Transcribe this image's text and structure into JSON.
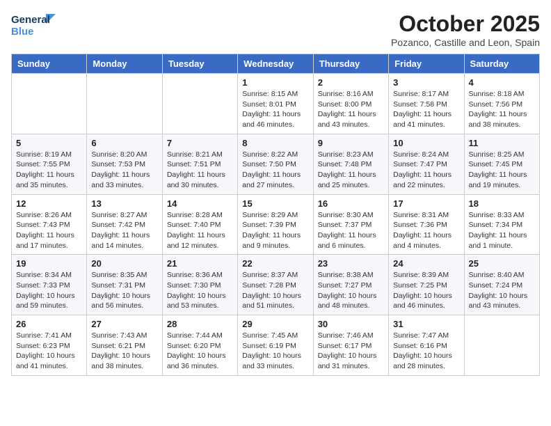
{
  "logo": {
    "line1": "General",
    "line2": "Blue"
  },
  "title": "October 2025",
  "location": "Pozanco, Castille and Leon, Spain",
  "weekdays": [
    "Sunday",
    "Monday",
    "Tuesday",
    "Wednesday",
    "Thursday",
    "Friday",
    "Saturday"
  ],
  "weeks": [
    [
      {
        "day": "",
        "info": ""
      },
      {
        "day": "",
        "info": ""
      },
      {
        "day": "",
        "info": ""
      },
      {
        "day": "1",
        "info": "Sunrise: 8:15 AM\nSunset: 8:01 PM\nDaylight: 11 hours and 46 minutes."
      },
      {
        "day": "2",
        "info": "Sunrise: 8:16 AM\nSunset: 8:00 PM\nDaylight: 11 hours and 43 minutes."
      },
      {
        "day": "3",
        "info": "Sunrise: 8:17 AM\nSunset: 7:58 PM\nDaylight: 11 hours and 41 minutes."
      },
      {
        "day": "4",
        "info": "Sunrise: 8:18 AM\nSunset: 7:56 PM\nDaylight: 11 hours and 38 minutes."
      }
    ],
    [
      {
        "day": "5",
        "info": "Sunrise: 8:19 AM\nSunset: 7:55 PM\nDaylight: 11 hours and 35 minutes."
      },
      {
        "day": "6",
        "info": "Sunrise: 8:20 AM\nSunset: 7:53 PM\nDaylight: 11 hours and 33 minutes."
      },
      {
        "day": "7",
        "info": "Sunrise: 8:21 AM\nSunset: 7:51 PM\nDaylight: 11 hours and 30 minutes."
      },
      {
        "day": "8",
        "info": "Sunrise: 8:22 AM\nSunset: 7:50 PM\nDaylight: 11 hours and 27 minutes."
      },
      {
        "day": "9",
        "info": "Sunrise: 8:23 AM\nSunset: 7:48 PM\nDaylight: 11 hours and 25 minutes."
      },
      {
        "day": "10",
        "info": "Sunrise: 8:24 AM\nSunset: 7:47 PM\nDaylight: 11 hours and 22 minutes."
      },
      {
        "day": "11",
        "info": "Sunrise: 8:25 AM\nSunset: 7:45 PM\nDaylight: 11 hours and 19 minutes."
      }
    ],
    [
      {
        "day": "12",
        "info": "Sunrise: 8:26 AM\nSunset: 7:43 PM\nDaylight: 11 hours and 17 minutes."
      },
      {
        "day": "13",
        "info": "Sunrise: 8:27 AM\nSunset: 7:42 PM\nDaylight: 11 hours and 14 minutes."
      },
      {
        "day": "14",
        "info": "Sunrise: 8:28 AM\nSunset: 7:40 PM\nDaylight: 11 hours and 12 minutes."
      },
      {
        "day": "15",
        "info": "Sunrise: 8:29 AM\nSunset: 7:39 PM\nDaylight: 11 hours and 9 minutes."
      },
      {
        "day": "16",
        "info": "Sunrise: 8:30 AM\nSunset: 7:37 PM\nDaylight: 11 hours and 6 minutes."
      },
      {
        "day": "17",
        "info": "Sunrise: 8:31 AM\nSunset: 7:36 PM\nDaylight: 11 hours and 4 minutes."
      },
      {
        "day": "18",
        "info": "Sunrise: 8:33 AM\nSunset: 7:34 PM\nDaylight: 11 hours and 1 minute."
      }
    ],
    [
      {
        "day": "19",
        "info": "Sunrise: 8:34 AM\nSunset: 7:33 PM\nDaylight: 10 hours and 59 minutes."
      },
      {
        "day": "20",
        "info": "Sunrise: 8:35 AM\nSunset: 7:31 PM\nDaylight: 10 hours and 56 minutes."
      },
      {
        "day": "21",
        "info": "Sunrise: 8:36 AM\nSunset: 7:30 PM\nDaylight: 10 hours and 53 minutes."
      },
      {
        "day": "22",
        "info": "Sunrise: 8:37 AM\nSunset: 7:28 PM\nDaylight: 10 hours and 51 minutes."
      },
      {
        "day": "23",
        "info": "Sunrise: 8:38 AM\nSunset: 7:27 PM\nDaylight: 10 hours and 48 minutes."
      },
      {
        "day": "24",
        "info": "Sunrise: 8:39 AM\nSunset: 7:25 PM\nDaylight: 10 hours and 46 minutes."
      },
      {
        "day": "25",
        "info": "Sunrise: 8:40 AM\nSunset: 7:24 PM\nDaylight: 10 hours and 43 minutes."
      }
    ],
    [
      {
        "day": "26",
        "info": "Sunrise: 7:41 AM\nSunset: 6:23 PM\nDaylight: 10 hours and 41 minutes."
      },
      {
        "day": "27",
        "info": "Sunrise: 7:43 AM\nSunset: 6:21 PM\nDaylight: 10 hours and 38 minutes."
      },
      {
        "day": "28",
        "info": "Sunrise: 7:44 AM\nSunset: 6:20 PM\nDaylight: 10 hours and 36 minutes."
      },
      {
        "day": "29",
        "info": "Sunrise: 7:45 AM\nSunset: 6:19 PM\nDaylight: 10 hours and 33 minutes."
      },
      {
        "day": "30",
        "info": "Sunrise: 7:46 AM\nSunset: 6:17 PM\nDaylight: 10 hours and 31 minutes."
      },
      {
        "day": "31",
        "info": "Sunrise: 7:47 AM\nSunset: 6:16 PM\nDaylight: 10 hours and 28 minutes."
      },
      {
        "day": "",
        "info": ""
      }
    ]
  ]
}
